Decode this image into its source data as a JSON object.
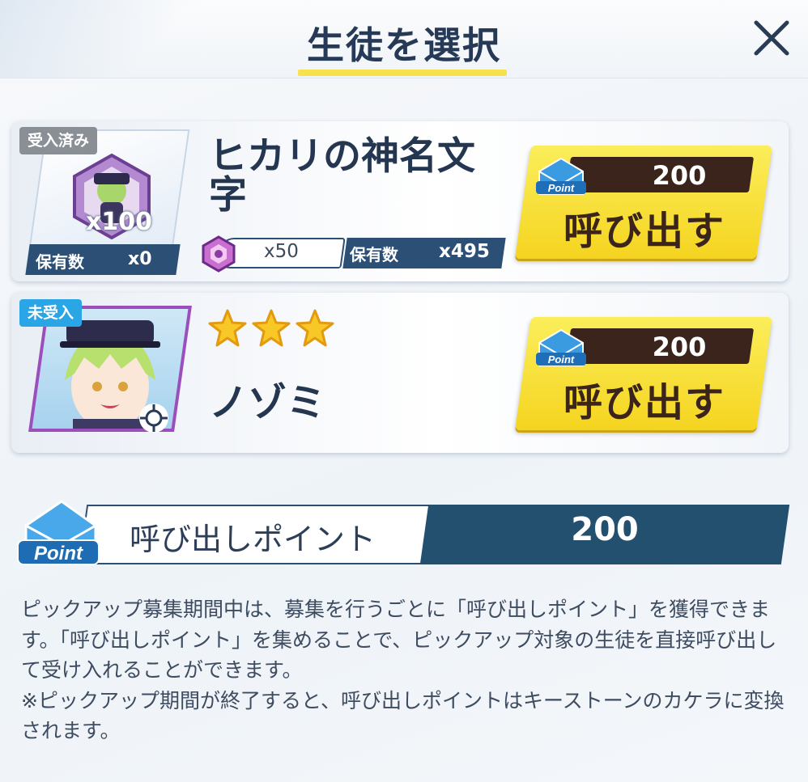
{
  "dialog": {
    "title": "生徒を選択",
    "close_icon": "close-icon"
  },
  "cards": [
    {
      "status": "受入済み",
      "item_icon": "eleph-crystal-icon",
      "item_count": "x100",
      "owned_label": "保有数",
      "owned_value": "x0",
      "name": "ヒカリの神名文字",
      "cost_icon": "eleph-gem-icon",
      "cost_value": "x50",
      "cost_owned_label": "保有数",
      "cost_owned_value": "x495",
      "button_cost": "200",
      "button_label": "呼び出す"
    },
    {
      "status": "未受入",
      "portrait": "student-portrait",
      "rarity_stars": 3,
      "name": "ノゾミ",
      "button_cost": "200",
      "button_label": "呼び出す"
    }
  ],
  "point": {
    "label": "呼び出しポイント",
    "value": "200"
  },
  "description": [
    "ピックアップ募集期間中は、募集を行うごとに「呼び出しポイント」を獲得できます。「呼び出しポイント」を集めることで、ピックアップ対象の生徒を直接呼び出して受け入れることができます。",
    "※ピックアップ期間が終了すると、呼び出しポイントはキーストーンのカケラに変換されます。"
  ],
  "colors": {
    "title": "#263a57",
    "accent_yellow": "#f6e24a",
    "dark_blue": "#24506f",
    "button_yellow": "#f5d420",
    "button_dark": "#3a241c",
    "badge_gray": "#8a8f96",
    "badge_blue": "#2aa6e6",
    "portrait_border": "#9b4fbc"
  }
}
